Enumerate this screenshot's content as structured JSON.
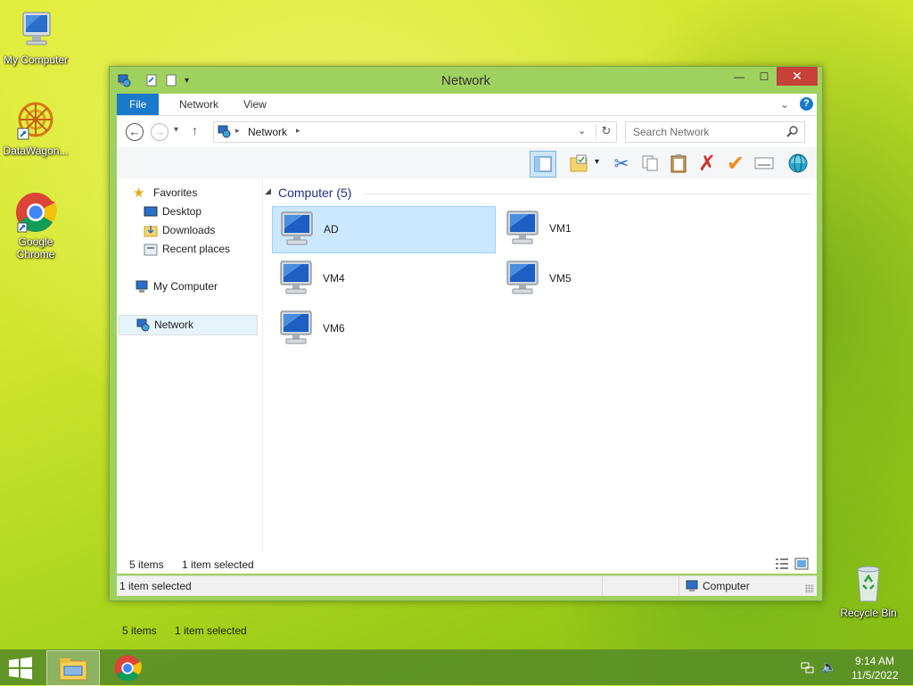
{
  "desktop": {
    "icons": [
      {
        "label": "My Computer",
        "icon": "computer-icon"
      },
      {
        "label": "DataWagon...",
        "icon": "datawagon-icon"
      },
      {
        "label": "Google Chrome",
        "icon": "chrome-icon"
      }
    ],
    "recycle_bin": "Recycle Bin"
  },
  "window": {
    "title": "Network",
    "close_symbol": "✕",
    "maximize_symbol": "☐",
    "minimize_symbol": "—",
    "ribbon_tabs": [
      "File",
      "Network",
      "View"
    ],
    "address": {
      "crumb": "Network"
    },
    "search": {
      "placeholder": "Search Network"
    },
    "nav": {
      "favorites": "Favorites",
      "desktop": "Desktop",
      "downloads": "Downloads",
      "recent": "Recent places",
      "my_computer": "My Computer",
      "network": "Network"
    },
    "group_header": "Computer (5)",
    "items": [
      {
        "name": "AD",
        "selected": true
      },
      {
        "name": "VM1",
        "selected": false
      },
      {
        "name": "VM4",
        "selected": false
      },
      {
        "name": "VM5",
        "selected": false
      },
      {
        "name": "VM6",
        "selected": false
      }
    ],
    "info": {
      "count": "5 items",
      "selection": "1 item selected"
    },
    "status": {
      "left": "1 item selected",
      "right": "Computer"
    }
  },
  "taskbar": {
    "time": "9:14 AM",
    "date": "11/5/2022"
  },
  "colors": {
    "accent": "#1979ca",
    "selection": "#cce8ff",
    "close": "#c7403a",
    "window_frame": "#9fd15e"
  }
}
